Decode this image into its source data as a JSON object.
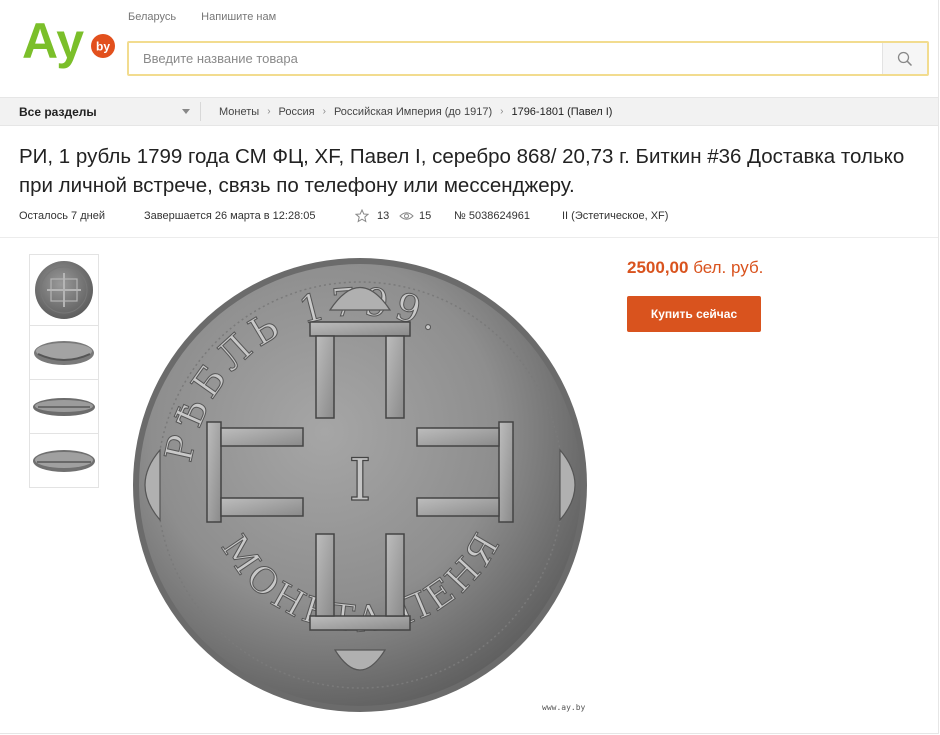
{
  "header": {
    "logo_text": "Ay",
    "logo_badge": "by",
    "links": [
      "Беларусь",
      "Напишите нам"
    ],
    "search_placeholder": "Введите название товара"
  },
  "nav": {
    "all_sections": "Все разделы",
    "breadcrumbs": [
      "Монеты",
      "Россия",
      "Российская Империя (до 1917)",
      "1796-1801 (Павел I)"
    ]
  },
  "lot": {
    "title": "РИ, 1 рубль 1799 года СМ ФЦ, XF, Павел I, серебро 868/ 20,73 г. Биткин #36 Доставка только при личной встрече, связь по телефону или мессенджеру.",
    "time_left": "Осталось 7 дней",
    "ends": "Завершается 26 марта в 12:28:05",
    "stars": "13",
    "views": "15",
    "lot_number": "№ 5038624961",
    "grade": "II (Эстетическое, XF)",
    "price_value": "2500,00",
    "price_currency": "бел. руб.",
    "buy_label": "Купить сейчас",
    "watermark": "www.ay.by",
    "coin_legend_top": "РѢБЛЬ 1799.",
    "coin_legend_bottom": "МОНЕТА ПЕНЯ",
    "coin_center": "I"
  },
  "colors": {
    "accent": "#d9531e",
    "logo_green": "#7bbf2a",
    "logo_badge": "#e2501d",
    "search_border": "#f2dc8f"
  },
  "icons": [
    "search-icon",
    "star-icon",
    "eye-icon",
    "chevron-down-icon"
  ]
}
